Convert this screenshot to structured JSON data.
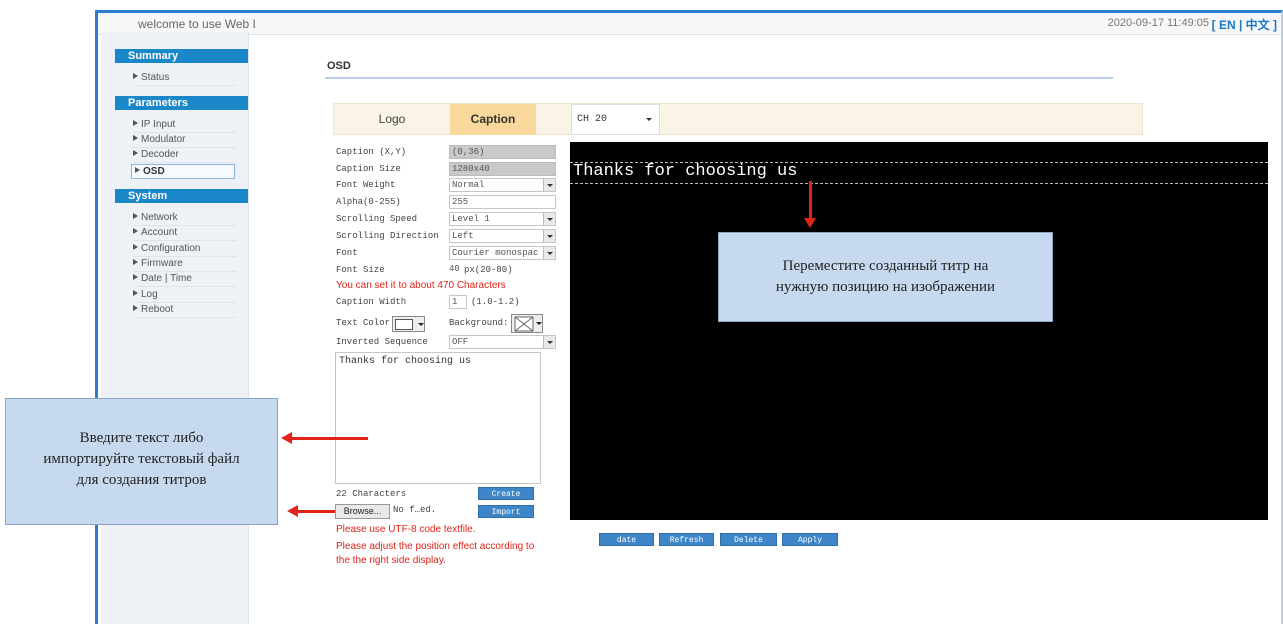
{
  "header": {
    "welcome": "welcome to use Web I",
    "datetime": "2020-09-17 11:49:05",
    "lang": "[ EN | 中文 ]"
  },
  "sidebar": {
    "summary_title": "Summary",
    "summary_items": [
      "Status"
    ],
    "parameters_title": "Parameters",
    "parameters_items": [
      "IP Input",
      "Modulator",
      "Decoder",
      "OSD"
    ],
    "system_title": "System",
    "system_items": [
      "Network",
      "Account",
      "Configuration",
      "Firmware",
      "Date | Time",
      "Log",
      "Reboot"
    ]
  },
  "page": {
    "title": "OSD"
  },
  "tabs": {
    "logo": "Logo",
    "caption": "Caption",
    "channel": "CH 20"
  },
  "form": {
    "caption_xy_label": "Caption (X,Y)",
    "caption_xy_value": "(0,36)",
    "caption_size_label": "Caption Size",
    "caption_size_value": "1280x40",
    "font_weight_label": "Font Weight",
    "font_weight_value": "Normal",
    "alpha_label": "Alpha(0-255)",
    "alpha_value": "255",
    "scroll_speed_label": "Scrolling Speed",
    "scroll_speed_value": "Level 1",
    "scroll_dir_label": "Scrolling Direction",
    "scroll_dir_value": "Left",
    "font_label": "Font",
    "font_value": "Courier monospac",
    "font_size_label": "Font Size",
    "font_size_value": "40",
    "font_size_hint": "px(20-80)",
    "chars_hint": "You can set it to about 470 Characters",
    "caption_width_label": "Caption Width",
    "caption_width_value": "1",
    "caption_width_hint": "(1.0-1.2)",
    "text_color_label": "Text Color",
    "background_label": "Background:",
    "inverted_label": "Inverted Sequence",
    "inverted_value": "OFF",
    "text": "Thanks for choosing us",
    "char_count": "22 Characters",
    "create": "Create",
    "import": "Import",
    "browse": "Browse...",
    "no_file": "No f…ed.",
    "note1": "Please use UTF-8 code textfile.",
    "note2": "Please adjust the position effect according to",
    "note3": "the the right side display."
  },
  "preview": {
    "caption": "Thanks for choosing us"
  },
  "buttons": {
    "date": "date",
    "refresh": "Refresh",
    "delete": "Delete",
    "apply": "Apply"
  },
  "annotations": {
    "right_line1": "Переместите созданный титр на",
    "right_line2": "нужную позицию на изображении",
    "left_line1": "Введите текст либо",
    "left_line2": "импортируйте текстовый файл",
    "left_line3": "для создания титров"
  },
  "colors": {
    "accent": "#1a87c9",
    "tab_active": "#fad79b",
    "annotation_arrow": "#e2231a",
    "callout": "#c7d9ef"
  }
}
